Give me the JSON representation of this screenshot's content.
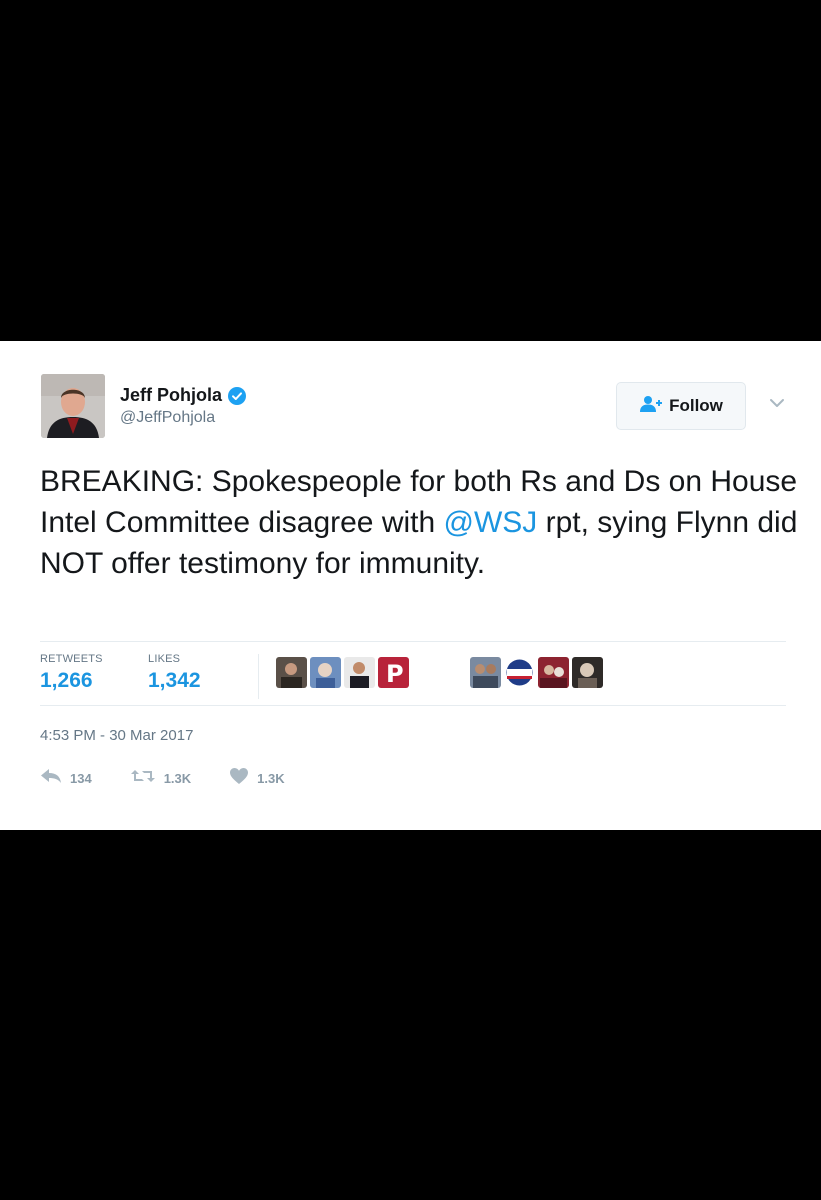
{
  "author": {
    "name": "Jeff Pohjola",
    "handle": "@JeffPohjola"
  },
  "follow": {
    "label": "Follow"
  },
  "tweet": {
    "text_before": "BREAKING: Spokespeople for both Rs and Ds on House Intel Committee disagree with ",
    "mention": "@WSJ",
    "text_after": " rpt, sying Flynn did NOT offer testimony for immunity."
  },
  "stats": {
    "retweets_label": "RETWEETS",
    "retweets_value": "1,266",
    "likes_label": "LIKES",
    "likes_value": "1,342"
  },
  "timestamp": "4:53 PM - 30 Mar 2017",
  "actions": {
    "reply_count": "134",
    "retweet_count": "1.3K",
    "like_count": "1.3K"
  },
  "colors": {
    "link": "#1b95e0",
    "muted": "#657786",
    "text": "#14171a",
    "background": "#000000",
    "card": "#ffffff"
  },
  "icons": [
    "verified-badge-icon",
    "follow-person-icon",
    "chevron-down-icon",
    "reply-icon",
    "retweet-icon",
    "heart-icon"
  ]
}
